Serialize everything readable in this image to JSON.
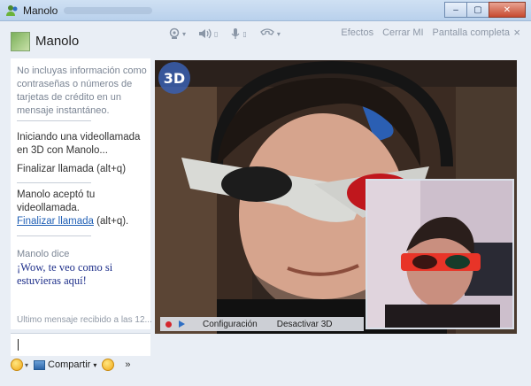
{
  "window": {
    "title": "Manolo",
    "controls": [
      "minimize",
      "maximize",
      "close"
    ]
  },
  "contact": {
    "name": "Manolo"
  },
  "toolbar": {
    "icons": [
      "webcam-icon",
      "speaker-icon",
      "microphone-icon",
      "call-icon"
    ],
    "links": {
      "effects": "Efectos",
      "close_mi": "Cerrar MI",
      "fullscreen": "Pantalla completa"
    },
    "close": "×"
  },
  "conversation": {
    "system_note": "No incluyas información como contraseñas o números de tarjetas de crédito en un mensaje instantáneo.",
    "msg1": "Iniciando una videollamada en 3D con Manolo...",
    "msg1_action": "Finalizar llamada (alt+q)",
    "msg2": "Manolo aceptó tu videollamada.",
    "msg2_link": "Finalizar llamada",
    "msg2_shortcut": "(alt+q).",
    "sender": "Manolo dice",
    "msg3": "¡Wow, te veo como si estuvieras aquí!",
    "last_received": "Último mensaje recibido a las 12..."
  },
  "bottom_bar": {
    "share_label": "Compartir",
    "more": "»"
  },
  "video": {
    "badge": "3D",
    "controls": {
      "settings": "Configuración",
      "disable3d": "Desactivar 3D"
    }
  }
}
